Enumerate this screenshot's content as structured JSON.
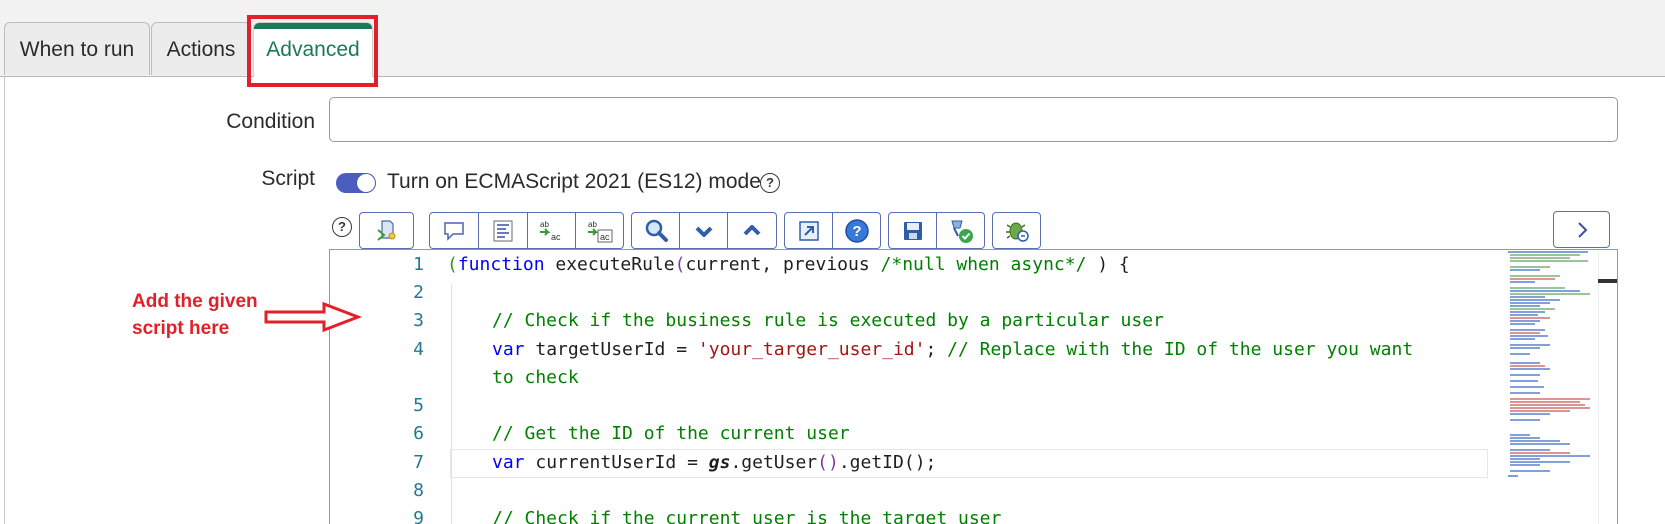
{
  "tabs": [
    {
      "label": "When to run",
      "active": false
    },
    {
      "label": "Actions",
      "active": false
    },
    {
      "label": "Advanced",
      "active": true
    }
  ],
  "form": {
    "condition_label": "Condition",
    "condition_value": "",
    "script_label": "Script",
    "es_toggle_label": "Turn on ECMAScript 2021 (ES12) mode",
    "es_toggle_on": true
  },
  "toolbar": {
    "buttons": [
      "script-include-icon",
      "comment-icon",
      "format-icon",
      "replace-icon",
      "replace-all-icon",
      "search-icon",
      "next-icon",
      "previous-icon",
      "fullscreen-icon",
      "help-icon",
      "save-icon",
      "test-icon",
      "debug-icon"
    ],
    "expand_icon": "chevron-right-icon"
  },
  "editor": {
    "line_numbers": [
      "1",
      "2",
      "3",
      "4",
      "",
      "5",
      "6",
      "7",
      "8",
      "9"
    ],
    "lines": {
      "l1_a": "(",
      "l1_b": "function",
      "l1_c": " executeRule",
      "l1_d": "(",
      "l1_e": "current, previous ",
      "l1_f": "/*null when async*/",
      "l1_g": " ) {",
      "l3": "// Check if the business rule is executed by a particular user",
      "l4_kw": "var",
      "l4_a": " targetUserId = ",
      "l4_str": "'your_targer_user_id'",
      "l4_b": "; ",
      "l4_cm": "// Replace with the ID of the user you want",
      "l4_wrap": "to check",
      "l6": "// Get the ID of the current user",
      "l7_kw": "var",
      "l7_a": " currentUserId = ",
      "l7_gs": "gs",
      "l7_b": ".getUser",
      "l7_c": "()",
      "l7_d": ".getID",
      "l7_e": "();",
      "l9": "// Check if the current user is the target user"
    }
  },
  "annotation": {
    "line1": "Add the given",
    "line2": "script here",
    "color": "#e3202a"
  },
  "colors": {
    "accent": "#1b7a5a",
    "highlight": "#e3202a",
    "toggle": "#4b5dbd",
    "toolbar_border": "#5b6db3"
  }
}
